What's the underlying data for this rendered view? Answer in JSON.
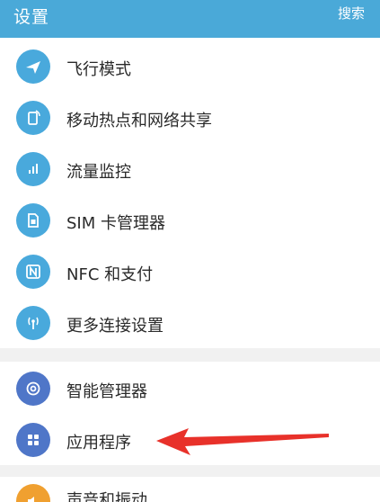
{
  "header": {
    "title": "设置",
    "search_label": "搜索",
    "bg_color": "#4aa9d8"
  },
  "connections": [
    {
      "label": "飞行模式",
      "icon": "airplane-icon",
      "color": "#49a9dc"
    },
    {
      "label": "移动热点和网络共享",
      "icon": "hotspot-phone-icon",
      "color": "#49a9dc"
    },
    {
      "label": "流量监控",
      "icon": "data-usage-icon",
      "color": "#49a9dc"
    },
    {
      "label": "SIM 卡管理器",
      "icon": "sim-card-icon",
      "color": "#49a9dc"
    },
    {
      "label": "NFC 和支付",
      "icon": "nfc-icon",
      "color": "#49a9dc"
    },
    {
      "label": "更多连接设置",
      "icon": "antenna-icon",
      "color": "#49a9dc"
    }
  ],
  "device": [
    {
      "label": "智能管理器",
      "icon": "smart-manager-icon",
      "color": "#4f76c8"
    },
    {
      "label": "应用程序",
      "icon": "apps-grid-icon",
      "color": "#4f76c8"
    }
  ],
  "partial": {
    "label": "声音和振动",
    "icon": "speaker-icon",
    "color": "#f0a030"
  },
  "annotation": {
    "arrow_color": "#e8312a"
  }
}
